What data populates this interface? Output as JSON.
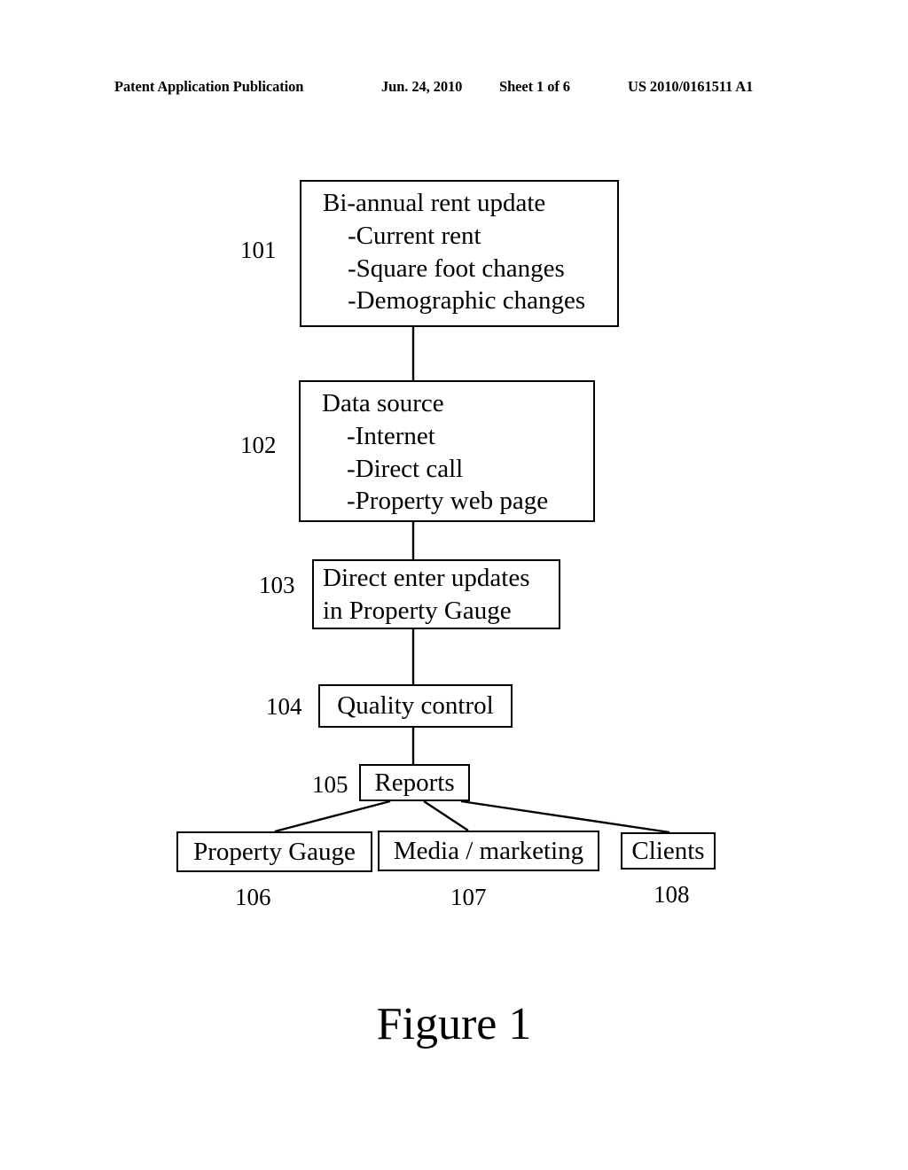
{
  "header": {
    "publication": "Patent Application Publication",
    "date": "Jun. 24, 2010",
    "sheet": "Sheet 1 of 6",
    "patent_number": "US 2010/0161511 A1"
  },
  "figure": {
    "caption": "Figure 1"
  },
  "nodes": {
    "n101": {
      "ref": "101",
      "title": "Bi-annual rent update",
      "items": [
        "-Current rent",
        "-Square foot changes",
        "-Demographic changes"
      ]
    },
    "n102": {
      "ref": "102",
      "title": "Data source",
      "items": [
        "-Internet",
        "-Direct call",
        "-Property web page"
      ]
    },
    "n103": {
      "ref": "103",
      "line1": "Direct enter updates",
      "line2": "in Property Gauge"
    },
    "n104": {
      "ref": "104",
      "label": "Quality control"
    },
    "n105": {
      "ref": "105",
      "label": "Reports"
    },
    "n106": {
      "ref": "106",
      "label": "Property Gauge"
    },
    "n107": {
      "ref": "107",
      "label": "Media / marketing"
    },
    "n108": {
      "ref": "108",
      "label": "Clients"
    }
  },
  "colors": {
    "stroke": "#000000",
    "background": "#ffffff"
  }
}
